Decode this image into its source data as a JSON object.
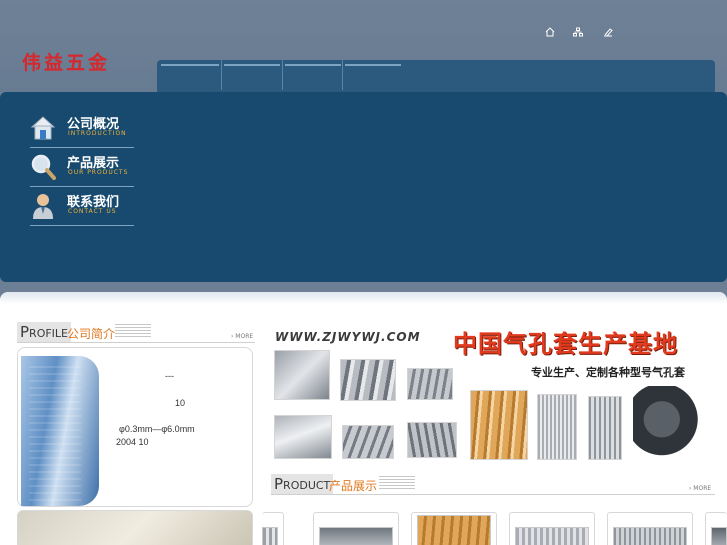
{
  "header": {
    "logo_text": "伟益五金",
    "top_icons": [
      "home-icon",
      "sitemap-icon",
      "bookmark-icon"
    ]
  },
  "menu": {
    "items": [
      {
        "title": "公司概况",
        "sub": "INTRODUCTION",
        "icon": "house-icon"
      },
      {
        "title": "产品展示",
        "sub": "OUR PRODUCTS",
        "icon": "magnifier-icon"
      },
      {
        "title": "联系我们",
        "sub": "CONTACT US",
        "icon": "person-icon"
      }
    ]
  },
  "profile": {
    "en_label_first": "P",
    "en_label_rest": "ROFILE",
    "cn_label": "公司简介",
    "more": "› MORE",
    "lines": [
      "---",
      "10",
      "φ0.3mm—φ6.0mm",
      "2004 10"
    ]
  },
  "banner": {
    "url": "WWW.ZJWYWJ.COM",
    "title": "中国气孔套生产基地",
    "subtitle": "专业生产、定制各种型号气孔套"
  },
  "products": {
    "en_label_first": "P",
    "en_label_rest": "RODUCT",
    "cn_label": "产品展示",
    "more": "› MORE"
  },
  "colors": {
    "band": "#174a6e",
    "nav": "#2b5a7e",
    "logo": "#d8262a",
    "accent_orange": "#e0781e",
    "banner_title": "#e13a1e"
  }
}
